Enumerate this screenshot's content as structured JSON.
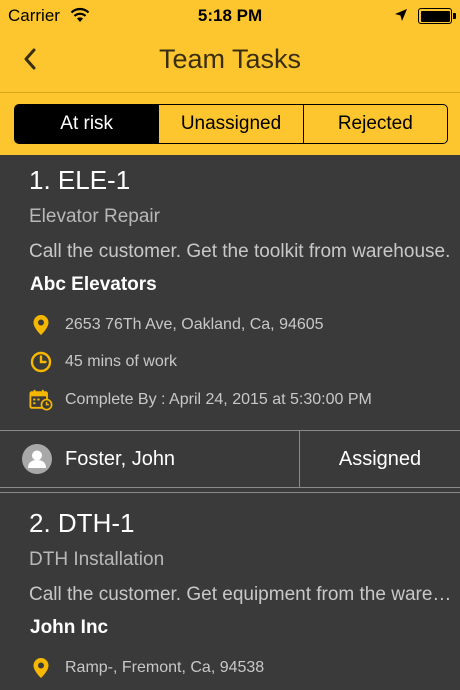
{
  "status_bar": {
    "carrier": "Carrier",
    "time": "5:18 PM"
  },
  "nav": {
    "title": "Team Tasks",
    "back_icon": "chevron-left-icon"
  },
  "tabs": [
    {
      "label": "At risk",
      "active": true
    },
    {
      "label": "Unassigned",
      "active": false
    },
    {
      "label": "Rejected",
      "active": false
    }
  ],
  "tasks": [
    {
      "title": "1. ELE-1",
      "type": "Elevator Repair",
      "description": "Call the customer. Get the toolkit from warehouse.",
      "customer": "Abc Elevators",
      "address": "2653 76Th Ave, Oakland, Ca, 94605",
      "duration": "45 mins of work",
      "complete_by": "Complete By : April 24, 2015 at 5:30:00 PM",
      "assignee": "Foster, John",
      "status": "Assigned"
    },
    {
      "title": "2. DTH-1",
      "type": "DTH Installation",
      "description": "Call the customer. Get equipment from the warehouse.",
      "customer": "John Inc",
      "address": "Ramp-, Fremont, Ca, 94538"
    }
  ],
  "colors": {
    "accent": "#fdc52e",
    "background": "#3a3a3a",
    "icon": "#f5b700"
  }
}
